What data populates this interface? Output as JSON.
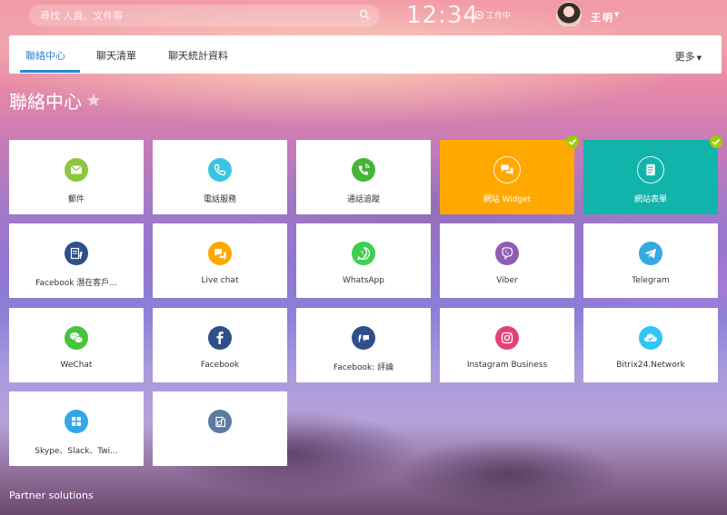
{
  "topbar": {
    "search_placeholder": "尋找 人員、文件等",
    "clock": "12:34",
    "work_status": "工作中",
    "user_name": "王明"
  },
  "tabs": [
    {
      "label": "聯絡中心",
      "active": true
    },
    {
      "label": "聊天清單",
      "active": false
    },
    {
      "label": "聊天統計資料",
      "active": false
    }
  ],
  "more_label": "更多",
  "page_title": "聯絡中心",
  "tiles": [
    {
      "label": "郵件",
      "icon": "mail-icon",
      "color": "#8cc63f"
    },
    {
      "label": "電話服務",
      "icon": "phone-icon",
      "color": "#3ac4e0"
    },
    {
      "label": "通話追蹤",
      "icon": "call-tracking-icon",
      "color": "#48b339"
    },
    {
      "label": "網站 Widget",
      "icon": "chat-widget-icon",
      "color": "#ffa900",
      "connected": true
    },
    {
      "label": "網站表單",
      "icon": "form-icon",
      "color": "#11b4ab",
      "connected": true
    },
    {
      "label": "Facebook 潛在客戶...",
      "icon": "facebook-leads-icon",
      "color": "#2d4f8b"
    },
    {
      "label": "Live chat",
      "icon": "live-chat-icon",
      "color": "#ffa900"
    },
    {
      "label": "WhatsApp",
      "icon": "whatsapp-icon",
      "color": "#3dcf4e"
    },
    {
      "label": "Viber",
      "icon": "viber-icon",
      "color": "#8f5db7"
    },
    {
      "label": "Telegram",
      "icon": "telegram-icon",
      "color": "#34aadf"
    },
    {
      "label": "WeChat",
      "icon": "wechat-icon",
      "color": "#45c43c"
    },
    {
      "label": "Facebook",
      "icon": "facebook-icon",
      "color": "#2d4f8b"
    },
    {
      "label": "Facebook: 評論",
      "icon": "facebook-comments-icon",
      "color": "#2d4f8b"
    },
    {
      "label": "Instagram Business",
      "icon": "instagram-icon",
      "color": "#e4407b"
    },
    {
      "label": "Bitrix24.Network",
      "icon": "bitrix-network-icon",
      "color": "#2fc6f6"
    },
    {
      "label": "Skype、Slack、Twi...",
      "icon": "skype-slack-icon",
      "color": "#2fa8e8"
    },
    {
      "label": "",
      "icon": "apps-icon",
      "color": "#5b7aa0"
    }
  ],
  "partner_solutions": "Partner solutions"
}
